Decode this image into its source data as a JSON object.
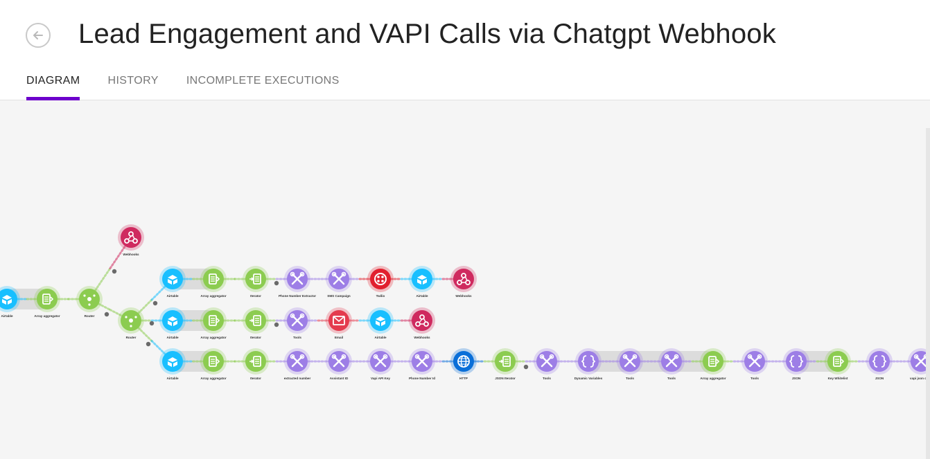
{
  "page": {
    "title": "Lead Engagement and VAPI Calls via Chatgpt Webhook"
  },
  "tabs": [
    {
      "label": "DIAGRAM",
      "active": true
    },
    {
      "label": "HISTORY",
      "active": false
    },
    {
      "label": "INCOMPLETE EXECUTIONS",
      "active": false
    }
  ],
  "colors": {
    "accent": "#6d00cc",
    "airtable": "#18bfff",
    "flow": "#8ccc50",
    "tools": "#9d7ee6",
    "webhook": "#cf2a5f",
    "twilio": "#e1202e",
    "email": "#e43b4e",
    "http": "#0a6fd8"
  },
  "scenario": {
    "nodes": [
      {
        "id": "n0",
        "label": "Airtable",
        "kind": "airtable"
      },
      {
        "id": "n1",
        "label": "Array aggregator",
        "kind": "aggregator"
      },
      {
        "id": "n2",
        "label": "Router",
        "kind": "router"
      },
      {
        "id": "n3",
        "label": "Webhooks",
        "kind": "webhook"
      },
      {
        "id": "n4",
        "label": "Router",
        "kind": "router"
      },
      {
        "id": "a1",
        "label": "Airtable",
        "kind": "airtable"
      },
      {
        "id": "a2",
        "label": "Array aggregator",
        "kind": "aggregator"
      },
      {
        "id": "a3",
        "label": "Iterator",
        "kind": "iterator"
      },
      {
        "id": "a4",
        "label": "Phone Number Extractor",
        "kind": "tools"
      },
      {
        "id": "a5",
        "label": "SMS Campaign",
        "kind": "tools"
      },
      {
        "id": "a6",
        "label": "Twilio",
        "kind": "twilio"
      },
      {
        "id": "a7",
        "label": "Airtable",
        "kind": "airtable"
      },
      {
        "id": "a8",
        "label": "Webhooks",
        "kind": "webhook"
      },
      {
        "id": "b1",
        "label": "Airtable",
        "kind": "airtable"
      },
      {
        "id": "b2",
        "label": "Array aggregator",
        "kind": "aggregator"
      },
      {
        "id": "b3",
        "label": "Iterator",
        "kind": "iterator"
      },
      {
        "id": "b4",
        "label": "Tools",
        "kind": "tools"
      },
      {
        "id": "b5",
        "label": "Email",
        "kind": "email"
      },
      {
        "id": "b6",
        "label": "Airtable",
        "kind": "airtable"
      },
      {
        "id": "b7",
        "label": "Webhooks",
        "kind": "webhook"
      },
      {
        "id": "c1",
        "label": "Airtable",
        "kind": "airtable"
      },
      {
        "id": "c2",
        "label": "Array aggregator",
        "kind": "aggregator"
      },
      {
        "id": "c3",
        "label": "Iterator",
        "kind": "iterator"
      },
      {
        "id": "c4",
        "label": "extracted number",
        "kind": "tools"
      },
      {
        "id": "c5",
        "label": "Assistant ID",
        "kind": "tools"
      },
      {
        "id": "c6",
        "label": "Vapi API Key",
        "kind": "tools"
      },
      {
        "id": "c7",
        "label": "Phone Number Id",
        "kind": "tools"
      },
      {
        "id": "c8",
        "label": "HTTP",
        "kind": "http"
      },
      {
        "id": "c9",
        "label": "JSON Iterator",
        "kind": "iterator"
      },
      {
        "id": "c10",
        "label": "Tools",
        "kind": "tools"
      },
      {
        "id": "c11",
        "label": "Dynamic Variables",
        "kind": "json"
      },
      {
        "id": "c12",
        "label": "Tools",
        "kind": "tools"
      },
      {
        "id": "c13",
        "label": "Tools",
        "kind": "tools"
      },
      {
        "id": "c14",
        "label": "Array aggregator",
        "kind": "aggregator"
      },
      {
        "id": "c15",
        "label": "Tools",
        "kind": "tools"
      },
      {
        "id": "c16",
        "label": "JSON",
        "kind": "json"
      },
      {
        "id": "c17",
        "label": "Key Whitelist",
        "kind": "aggregator"
      },
      {
        "id": "c18",
        "label": "JSON",
        "kind": "json"
      },
      {
        "id": "c19",
        "label": "vapi json conv",
        "kind": "tools"
      }
    ]
  }
}
